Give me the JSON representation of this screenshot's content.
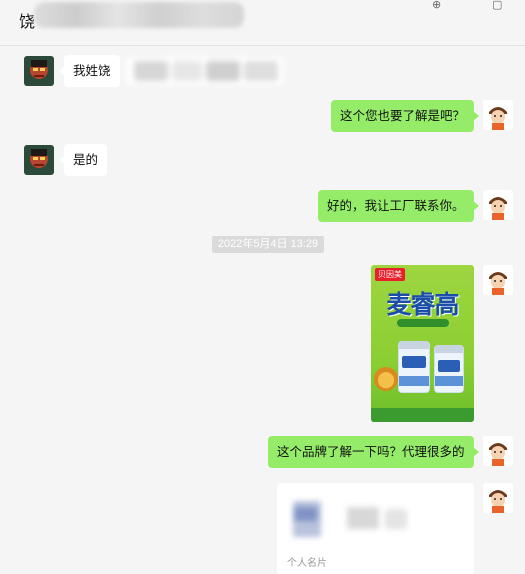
{
  "header": {
    "title": "饶",
    "icons": [
      "pin-icon",
      "window-icon"
    ]
  },
  "messages": [
    {
      "side": "left",
      "text": "我姓饶"
    },
    {
      "side": "right",
      "text": "这个您也要了解是吧？"
    },
    {
      "side": "left",
      "text": "是的"
    },
    {
      "side": "right",
      "text": "好的，我让工厂联系你。"
    },
    {
      "type": "timestamp",
      "text": "2022年5月4日 13:29"
    },
    {
      "side": "right",
      "type": "image",
      "brand": "贝因美",
      "product_title": "麦睿高"
    },
    {
      "side": "right",
      "text": "这个品牌了解一下吗？代理很多的"
    },
    {
      "side": "right",
      "type": "card",
      "label": "个人名片"
    }
  ],
  "colors": {
    "background": "#f5f5f5",
    "bubble_self": "#95ec69",
    "bubble_other": "#ffffff",
    "timestamp_bg": "#dadada"
  }
}
